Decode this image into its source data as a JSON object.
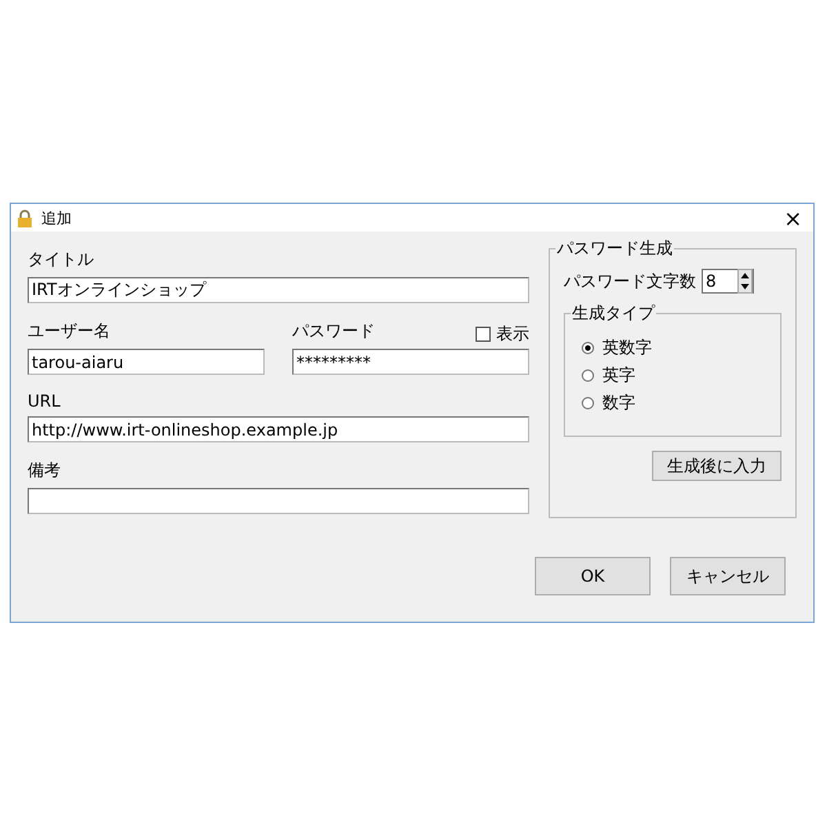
{
  "window": {
    "title": "追加",
    "close": "×"
  },
  "form": {
    "title": {
      "label": "タイトル",
      "value": "IRTオンラインショップ"
    },
    "username": {
      "label": "ユーザー名",
      "value": "tarou-aiaru"
    },
    "password": {
      "label": "パスワード",
      "value": "*********",
      "show": {
        "label": "表示",
        "checked": false
      }
    },
    "url": {
      "label": "URL",
      "value": "http://www.irt-onlineshop.example.jp"
    },
    "notes": {
      "label": "備考"
    }
  },
  "generator": {
    "title": "パスワード生成",
    "length_label": "パスワード文字数",
    "length_value": "8",
    "type_group": {
      "title": "生成タイプ",
      "options": [
        {
          "label": "英数字",
          "selected": true
        },
        {
          "label": "英字",
          "selected": false
        },
        {
          "label": "数字",
          "selected": false
        }
      ]
    },
    "button": "生成後に入力"
  },
  "buttons": [
    "OK",
    "キャンセル"
  ]
}
